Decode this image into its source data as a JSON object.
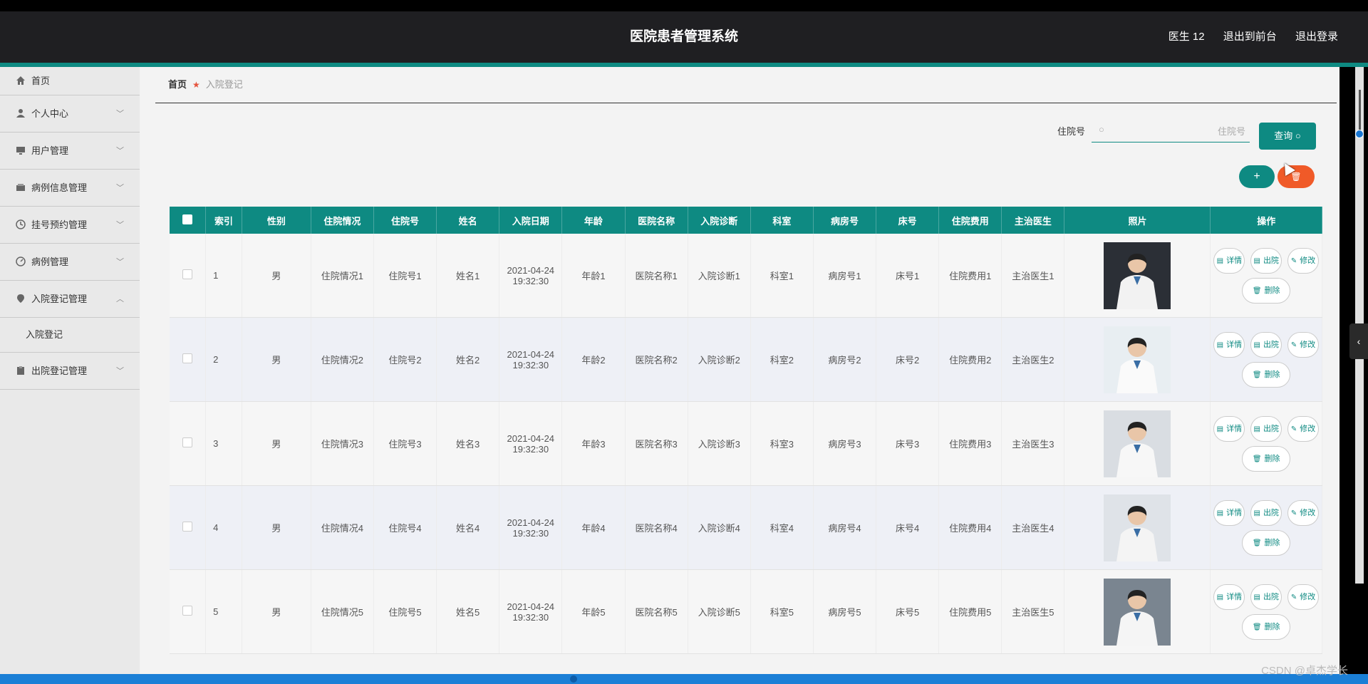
{
  "app": {
    "title": "医院患者管理系统",
    "user": "医生 12",
    "front_link": "退出到前台",
    "logout_link": "退出登录"
  },
  "sidebar": {
    "items": [
      {
        "label": "首页",
        "icon": "home-icon",
        "expandable": false
      },
      {
        "label": "个人中心",
        "icon": "user-icon",
        "expandable": true
      },
      {
        "label": "用户管理",
        "icon": "monitor-icon",
        "expandable": true
      },
      {
        "label": "病例信息管理",
        "icon": "wallet-icon",
        "expandable": true
      },
      {
        "label": "挂号预约管理",
        "icon": "clock-icon",
        "expandable": true
      },
      {
        "label": "病例管理",
        "icon": "gauge-icon",
        "expandable": true
      },
      {
        "label": "入院登记管理",
        "icon": "location-icon",
        "expandable": true,
        "expanded": true
      },
      {
        "label": "出院登记管理",
        "icon": "clipboard-icon",
        "expandable": true
      }
    ],
    "submenu_label": "入院登记"
  },
  "breadcrumb": {
    "home": "首页",
    "current": "入院登记"
  },
  "search": {
    "label": "住院号",
    "placeholder": "住院号",
    "query_label": "查询"
  },
  "actions": {
    "add_label": "+",
    "delete_icon": "trash-icon"
  },
  "table": {
    "headers": [
      "索引",
      "性别",
      "住院情况",
      "住院号",
      "姓名",
      "入院日期",
      "年龄",
      "医院名称",
      "入院诊断",
      "科室",
      "病房号",
      "床号",
      "住院费用",
      "主治医生",
      "照片",
      "操作"
    ],
    "op_labels": {
      "detail": "详情",
      "discharge": "出院",
      "edit": "修改",
      "delete": "删除"
    },
    "rows": [
      {
        "idx": "1",
        "gender": "男",
        "status": "住院情况1",
        "inpatient_no": "住院号1",
        "name": "姓名1",
        "date": "2021-04-24 19:32:30",
        "age": "年龄1",
        "hospital": "医院名称1",
        "diagnosis": "入院诊断1",
        "dept": "科室1",
        "ward": "病房号1",
        "bed": "床号1",
        "fee": "住院费用1",
        "doctor": "主治医生1"
      },
      {
        "idx": "2",
        "gender": "男",
        "status": "住院情况2",
        "inpatient_no": "住院号2",
        "name": "姓名2",
        "date": "2021-04-24 19:32:30",
        "age": "年龄2",
        "hospital": "医院名称2",
        "diagnosis": "入院诊断2",
        "dept": "科室2",
        "ward": "病房号2",
        "bed": "床号2",
        "fee": "住院费用2",
        "doctor": "主治医生2"
      },
      {
        "idx": "3",
        "gender": "男",
        "status": "住院情况3",
        "inpatient_no": "住院号3",
        "name": "姓名3",
        "date": "2021-04-24 19:32:30",
        "age": "年龄3",
        "hospital": "医院名称3",
        "diagnosis": "入院诊断3",
        "dept": "科室3",
        "ward": "病房号3",
        "bed": "床号3",
        "fee": "住院费用3",
        "doctor": "主治医生3"
      },
      {
        "idx": "4",
        "gender": "男",
        "status": "住院情况4",
        "inpatient_no": "住院号4",
        "name": "姓名4",
        "date": "2021-04-24 19:32:30",
        "age": "年龄4",
        "hospital": "医院名称4",
        "diagnosis": "入院诊断4",
        "dept": "科室4",
        "ward": "病房号4",
        "bed": "床号4",
        "fee": "住院费用4",
        "doctor": "主治医生4"
      },
      {
        "idx": "5",
        "gender": "男",
        "status": "住院情况5",
        "inpatient_no": "住院号5",
        "name": "姓名5",
        "date": "2021-04-24 19:32:30",
        "age": "年龄5",
        "hospital": "医院名称5",
        "diagnosis": "入院诊断5",
        "dept": "科室5",
        "ward": "病房号5",
        "bed": "床号5",
        "fee": "住院费用5",
        "doctor": "主治医生5"
      }
    ]
  },
  "watermark": "CSDN @卓杰学长",
  "colors": {
    "accent": "#0e8a82",
    "danger": "#f05a28",
    "header_bg": "#1f1f22"
  }
}
